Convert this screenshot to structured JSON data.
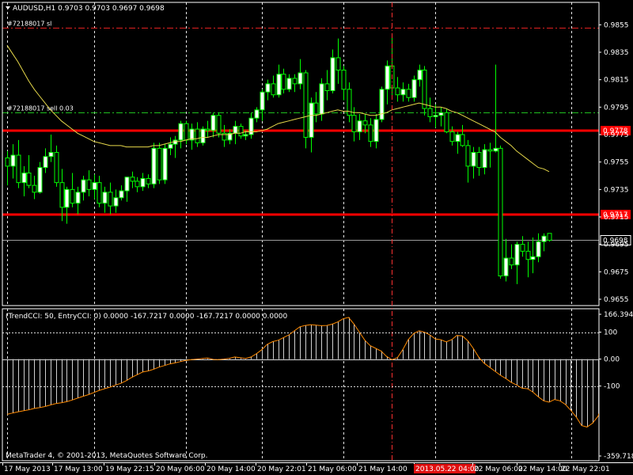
{
  "chart_data": [
    {
      "type": "candlestick",
      "title": "AUDUSD,H1  0.9703 0.9703 0.9697 0.9698",
      "ylim": [
        0.9655,
        0.9865
      ],
      "y_ticks": [
        "0.9855",
        "0.9835",
        "0.9815",
        "0.9795",
        "0.9775",
        "0.9755",
        "0.9735",
        "0.9715",
        "0.9695",
        "0.9675",
        "0.9655"
      ],
      "x_ticks": [
        "17 May 2013",
        "17 May 13:00",
        "19 May 22:15",
        "20 May 06:00",
        "20 May 14:00",
        "20 May 22:01",
        "21 May 06:00",
        "21 May 14:00",
        "2013.05.22 04:00",
        "22 May 06:00",
        "22 May 14:00",
        "22 May 22:01"
      ],
      "candles": [
        {
          "o": 0.9758,
          "h": 0.9763,
          "l": 0.9738,
          "c": 0.9752
        },
        {
          "o": 0.9752,
          "h": 0.9768,
          "l": 0.9743,
          "c": 0.976
        },
        {
          "o": 0.976,
          "h": 0.9771,
          "l": 0.9736,
          "c": 0.974
        },
        {
          "o": 0.974,
          "h": 0.9752,
          "l": 0.973,
          "c": 0.9747
        },
        {
          "o": 0.9747,
          "h": 0.976,
          "l": 0.9736,
          "c": 0.9738
        },
        {
          "o": 0.9738,
          "h": 0.9745,
          "l": 0.9728,
          "c": 0.9733
        },
        {
          "o": 0.9733,
          "h": 0.9755,
          "l": 0.9732,
          "c": 0.9751
        },
        {
          "o": 0.9751,
          "h": 0.9765,
          "l": 0.9747,
          "c": 0.9759
        },
        {
          "o": 0.9759,
          "h": 0.9775,
          "l": 0.9755,
          "c": 0.9762
        },
        {
          "o": 0.9762,
          "h": 0.9767,
          "l": 0.9737,
          "c": 0.974
        },
        {
          "o": 0.974,
          "h": 0.975,
          "l": 0.9712,
          "c": 0.9722
        },
        {
          "o": 0.9722,
          "h": 0.9737,
          "l": 0.971,
          "c": 0.9735
        },
        {
          "o": 0.9735,
          "h": 0.9747,
          "l": 0.9722,
          "c": 0.9725
        },
        {
          "o": 0.9725,
          "h": 0.9737,
          "l": 0.9717,
          "c": 0.9733
        },
        {
          "o": 0.9733,
          "h": 0.9745,
          "l": 0.9727,
          "c": 0.9742
        },
        {
          "o": 0.9742,
          "h": 0.9749,
          "l": 0.973,
          "c": 0.9735
        },
        {
          "o": 0.9735,
          "h": 0.9746,
          "l": 0.9728,
          "c": 0.974
        },
        {
          "o": 0.974,
          "h": 0.9745,
          "l": 0.9722,
          "c": 0.9725
        },
        {
          "o": 0.9725,
          "h": 0.9737,
          "l": 0.9718,
          "c": 0.9733
        },
        {
          "o": 0.9733,
          "h": 0.974,
          "l": 0.9717,
          "c": 0.9723
        },
        {
          "o": 0.9723,
          "h": 0.9735,
          "l": 0.9718,
          "c": 0.9729
        },
        {
          "o": 0.9729,
          "h": 0.9738,
          "l": 0.9727,
          "c": 0.9734
        },
        {
          "o": 0.9734,
          "h": 0.9744,
          "l": 0.9726,
          "c": 0.9744
        },
        {
          "o": 0.9744,
          "h": 0.9748,
          "l": 0.9736,
          "c": 0.9741
        },
        {
          "o": 0.9741,
          "h": 0.9744,
          "l": 0.9733,
          "c": 0.9737
        },
        {
          "o": 0.9737,
          "h": 0.9747,
          "l": 0.9734,
          "c": 0.9743
        },
        {
          "o": 0.9743,
          "h": 0.9746,
          "l": 0.9736,
          "c": 0.9739
        },
        {
          "o": 0.9739,
          "h": 0.9769,
          "l": 0.9736,
          "c": 0.9765
        },
        {
          "o": 0.9765,
          "h": 0.9769,
          "l": 0.9739,
          "c": 0.9742
        },
        {
          "o": 0.9742,
          "h": 0.9768,
          "l": 0.9739,
          "c": 0.9765
        },
        {
          "o": 0.9765,
          "h": 0.9773,
          "l": 0.976,
          "c": 0.9768
        },
        {
          "o": 0.9768,
          "h": 0.9774,
          "l": 0.9758,
          "c": 0.9771
        },
        {
          "o": 0.9771,
          "h": 0.9785,
          "l": 0.9765,
          "c": 0.9783
        },
        {
          "o": 0.9783,
          "h": 0.9785,
          "l": 0.9768,
          "c": 0.9771
        },
        {
          "o": 0.9771,
          "h": 0.9783,
          "l": 0.9764,
          "c": 0.9779
        },
        {
          "o": 0.9779,
          "h": 0.9784,
          "l": 0.9766,
          "c": 0.9769
        },
        {
          "o": 0.9769,
          "h": 0.9781,
          "l": 0.9767,
          "c": 0.9779
        },
        {
          "o": 0.9779,
          "h": 0.9785,
          "l": 0.9773,
          "c": 0.9778
        },
        {
          "o": 0.9778,
          "h": 0.9791,
          "l": 0.9773,
          "c": 0.9789
        },
        {
          "o": 0.9789,
          "h": 0.9791,
          "l": 0.9773,
          "c": 0.9776
        },
        {
          "o": 0.9776,
          "h": 0.9782,
          "l": 0.9766,
          "c": 0.9771
        },
        {
          "o": 0.9771,
          "h": 0.9779,
          "l": 0.9768,
          "c": 0.9776
        },
        {
          "o": 0.9776,
          "h": 0.9785,
          "l": 0.9768,
          "c": 0.9781
        },
        {
          "o": 0.9781,
          "h": 0.9783,
          "l": 0.9772,
          "c": 0.9774
        },
        {
          "o": 0.9774,
          "h": 0.9778,
          "l": 0.9771,
          "c": 0.9775
        },
        {
          "o": 0.9775,
          "h": 0.9791,
          "l": 0.9772,
          "c": 0.9787
        },
        {
          "o": 0.9787,
          "h": 0.9795,
          "l": 0.9784,
          "c": 0.9793
        },
        {
          "o": 0.9793,
          "h": 0.9808,
          "l": 0.9785,
          "c": 0.9806
        },
        {
          "o": 0.9806,
          "h": 0.9815,
          "l": 0.98,
          "c": 0.9812
        },
        {
          "o": 0.9812,
          "h": 0.9818,
          "l": 0.9802,
          "c": 0.9804
        },
        {
          "o": 0.9804,
          "h": 0.9826,
          "l": 0.9802,
          "c": 0.9819
        },
        {
          "o": 0.9819,
          "h": 0.9823,
          "l": 0.9805,
          "c": 0.9808
        },
        {
          "o": 0.9808,
          "h": 0.9819,
          "l": 0.9806,
          "c": 0.9816
        },
        {
          "o": 0.9816,
          "h": 0.9819,
          "l": 0.9806,
          "c": 0.9812
        },
        {
          "o": 0.9812,
          "h": 0.983,
          "l": 0.9808,
          "c": 0.982
        },
        {
          "o": 0.982,
          "h": 0.9822,
          "l": 0.9765,
          "c": 0.9773
        },
        {
          "o": 0.9773,
          "h": 0.9802,
          "l": 0.9762,
          "c": 0.9798
        },
        {
          "o": 0.9798,
          "h": 0.9806,
          "l": 0.9784,
          "c": 0.979
        },
        {
          "o": 0.979,
          "h": 0.9816,
          "l": 0.9785,
          "c": 0.9812
        },
        {
          "o": 0.9812,
          "h": 0.9822,
          "l": 0.98,
          "c": 0.9807
        },
        {
          "o": 0.9807,
          "h": 0.9837,
          "l": 0.9805,
          "c": 0.9831
        },
        {
          "o": 0.9831,
          "h": 0.9845,
          "l": 0.9812,
          "c": 0.9822
        },
        {
          "o": 0.9822,
          "h": 0.9825,
          "l": 0.98,
          "c": 0.9808
        },
        {
          "o": 0.9808,
          "h": 0.9813,
          "l": 0.9784,
          "c": 0.9789
        },
        {
          "o": 0.9789,
          "h": 0.9795,
          "l": 0.977,
          "c": 0.9777
        },
        {
          "o": 0.9777,
          "h": 0.979,
          "l": 0.9771,
          "c": 0.9785
        },
        {
          "o": 0.9785,
          "h": 0.979,
          "l": 0.9776,
          "c": 0.9782
        },
        {
          "o": 0.9782,
          "h": 0.9787,
          "l": 0.9766,
          "c": 0.977
        },
        {
          "o": 0.977,
          "h": 0.979,
          "l": 0.9765,
          "c": 0.9786
        },
        {
          "o": 0.9786,
          "h": 0.981,
          "l": 0.9784,
          "c": 0.9808
        },
        {
          "o": 0.9808,
          "h": 0.9829,
          "l": 0.9797,
          "c": 0.9825
        },
        {
          "o": 0.9825,
          "h": 0.9846,
          "l": 0.9803,
          "c": 0.9809
        },
        {
          "o": 0.9809,
          "h": 0.9817,
          "l": 0.9799,
          "c": 0.9804
        },
        {
          "o": 0.9804,
          "h": 0.9813,
          "l": 0.9799,
          "c": 0.9808
        },
        {
          "o": 0.9808,
          "h": 0.9812,
          "l": 0.9799,
          "c": 0.9802
        },
        {
          "o": 0.9802,
          "h": 0.9818,
          "l": 0.9799,
          "c": 0.9815
        },
        {
          "o": 0.9815,
          "h": 0.9826,
          "l": 0.981,
          "c": 0.9822
        },
        {
          "o": 0.9822,
          "h": 0.9825,
          "l": 0.9789,
          "c": 0.9794
        },
        {
          "o": 0.9794,
          "h": 0.9802,
          "l": 0.9784,
          "c": 0.9788
        },
        {
          "o": 0.9788,
          "h": 0.9797,
          "l": 0.978,
          "c": 0.9789
        },
        {
          "o": 0.9789,
          "h": 0.9795,
          "l": 0.9781,
          "c": 0.9791
        },
        {
          "o": 0.9791,
          "h": 0.9794,
          "l": 0.9776,
          "c": 0.9777
        },
        {
          "o": 0.9777,
          "h": 0.9781,
          "l": 0.9767,
          "c": 0.977
        },
        {
          "o": 0.977,
          "h": 0.9777,
          "l": 0.9761,
          "c": 0.9775
        },
        {
          "o": 0.9775,
          "h": 0.9782,
          "l": 0.9766,
          "c": 0.9767
        },
        {
          "o": 0.9767,
          "h": 0.9771,
          "l": 0.974,
          "c": 0.9752
        },
        {
          "o": 0.9752,
          "h": 0.9766,
          "l": 0.9743,
          "c": 0.9762
        },
        {
          "o": 0.9762,
          "h": 0.9766,
          "l": 0.9745,
          "c": 0.9751
        },
        {
          "o": 0.9751,
          "h": 0.9768,
          "l": 0.9746,
          "c": 0.9764
        },
        {
          "o": 0.9764,
          "h": 0.9769,
          "l": 0.9751,
          "c": 0.9763
        },
        {
          "o": 0.9763,
          "h": 0.9826,
          "l": 0.9762,
          "c": 0.9765
        },
        {
          "o": 0.9765,
          "h": 0.9767,
          "l": 0.967,
          "c": 0.9672
        },
        {
          "o": 0.9672,
          "h": 0.9699,
          "l": 0.9668,
          "c": 0.9685
        },
        {
          "o": 0.9685,
          "h": 0.9695,
          "l": 0.9677,
          "c": 0.968
        },
        {
          "o": 0.968,
          "h": 0.9697,
          "l": 0.9666,
          "c": 0.9695
        },
        {
          "o": 0.9695,
          "h": 0.9701,
          "l": 0.9686,
          "c": 0.969
        },
        {
          "o": 0.969,
          "h": 0.9697,
          "l": 0.9671,
          "c": 0.9684
        },
        {
          "o": 0.9684,
          "h": 0.97,
          "l": 0.9674,
          "c": 0.9686
        },
        {
          "o": 0.9686,
          "h": 0.9703,
          "l": 0.9682,
          "c": 0.9697
        },
        {
          "o": 0.9697,
          "h": 0.9703,
          "l": 0.969,
          "c": 0.9701
        },
        {
          "o": 0.9703,
          "h": 0.9703,
          "l": 0.9697,
          "c": 0.9698
        }
      ],
      "moving_average": {
        "color": "#e6d84a",
        "values": [
          0.984,
          0.9834,
          0.9828,
          0.9821,
          0.9814,
          0.9808,
          0.9803,
          0.9798,
          0.9793,
          0.9789,
          0.9785,
          0.9782,
          0.9779,
          0.9776,
          0.9774,
          0.9772,
          0.977,
          0.9769,
          0.9768,
          0.9767,
          0.9767,
          0.9767,
          0.9766,
          0.9766,
          0.9766,
          0.9766,
          0.9766,
          0.9767,
          0.9767,
          0.9768,
          0.9769,
          0.977,
          0.977,
          0.9771,
          0.9772,
          0.9772,
          0.9773,
          0.9773,
          0.9774,
          0.9775,
          0.9775,
          0.9775,
          0.9776,
          0.9776,
          0.9777,
          0.9777,
          0.9777,
          0.9778,
          0.9779,
          0.9781,
          0.9783,
          0.9784,
          0.9785,
          0.9786,
          0.9787,
          0.9788,
          0.9789,
          0.9789,
          0.979,
          0.9791,
          0.9792,
          0.9793,
          0.9792,
          0.9792,
          0.9791,
          0.9791,
          0.979,
          0.9789,
          0.9789,
          0.979,
          0.9791,
          0.9793,
          0.9794,
          0.9795,
          0.9796,
          0.9797,
          0.9798,
          0.9797,
          0.9796,
          0.9795,
          0.9795,
          0.9794,
          0.9792,
          0.9791,
          0.9789,
          0.9787,
          0.9785,
          0.9783,
          0.9781,
          0.9779,
          0.9777,
          0.9773,
          0.977,
          0.9767,
          0.9763,
          0.976,
          0.9757,
          0.9754,
          0.9751,
          0.975,
          0.9748
        ]
      },
      "order_lines": [
        {
          "label": "#72188017 sl",
          "price": 0.9853,
          "color": "#e02020"
        },
        {
          "label": "#72188017 sell 0.03",
          "price": 0.9791,
          "color": "#20c020"
        }
      ],
      "horizontal_lines": [
        {
          "price": 0.9778,
          "label": "0.9778",
          "color": "#ff0000"
        },
        {
          "price": 0.9717,
          "label": "0.9717",
          "color": "#ff0000"
        }
      ],
      "current_price": {
        "price": 0.9698,
        "label": "0.9698"
      },
      "vertical_lines_candle_index": [
        0,
        16,
        33,
        47,
        62,
        79
      ],
      "session_marker_candle_index": 71
    },
    {
      "type": "histogram",
      "title": "(TrendCCI: 50, EntryCCI: 0)  0.0000  -167.7217  0.0000  -167.7217  0.0000  0.0000",
      "ylim": [
        -359.7187,
        166.3945
      ],
      "y_ticks": [
        "166.3945",
        "100",
        "0.00",
        "-100",
        "-359.7187"
      ],
      "levels": [
        100,
        0,
        -100
      ],
      "values": [
        -205,
        -200,
        -196,
        -192,
        -188,
        -183,
        -180,
        -176,
        -170,
        -165,
        -162,
        -158,
        -152,
        -145,
        -138,
        -132,
        -124,
        -116,
        -110,
        -104,
        -96,
        -90,
        -80,
        -68,
        -58,
        -48,
        -44,
        -38,
        -30,
        -24,
        -18,
        -14,
        -9,
        -5,
        -2,
        0,
        2,
        4,
        -1,
        -2,
        0,
        3,
        8,
        5,
        2,
        8,
        20,
        35,
        55,
        65,
        70,
        80,
        90,
        105,
        120,
        125,
        128,
        126,
        124,
        125,
        130,
        138,
        150,
        155,
        130,
        100,
        70,
        50,
        40,
        30,
        10,
        -2,
        5,
        35,
        72,
        95,
        105,
        100,
        90,
        75,
        72,
        64,
        72,
        88,
        86,
        68,
        40,
        8,
        -15,
        -30,
        -45,
        -60,
        -72,
        -86,
        -96,
        -108,
        -110,
        -122,
        -140,
        -155,
        -160,
        -150,
        -155,
        -168,
        -190,
        -215,
        -247,
        -252,
        -238,
        -213,
        -167.7217
      ]
    }
  ],
  "footer": {
    "copyright": "MetaTrader 4, © 2001-2013, MetaQuotes Software Corp."
  },
  "colors": {
    "background": "#000000",
    "axis": "#ffffff",
    "bull_body": "#ffffff",
    "bear_body": "#000000",
    "wick": "#00ff00",
    "grid": "#e8e8e8",
    "red_line": "#ff0000",
    "cci_line": "#ff8c00",
    "hist_bar": "#d0d0d0",
    "level_line": "#d8d8d8"
  },
  "icons": {
    "menu": "triangle-down-icon"
  }
}
